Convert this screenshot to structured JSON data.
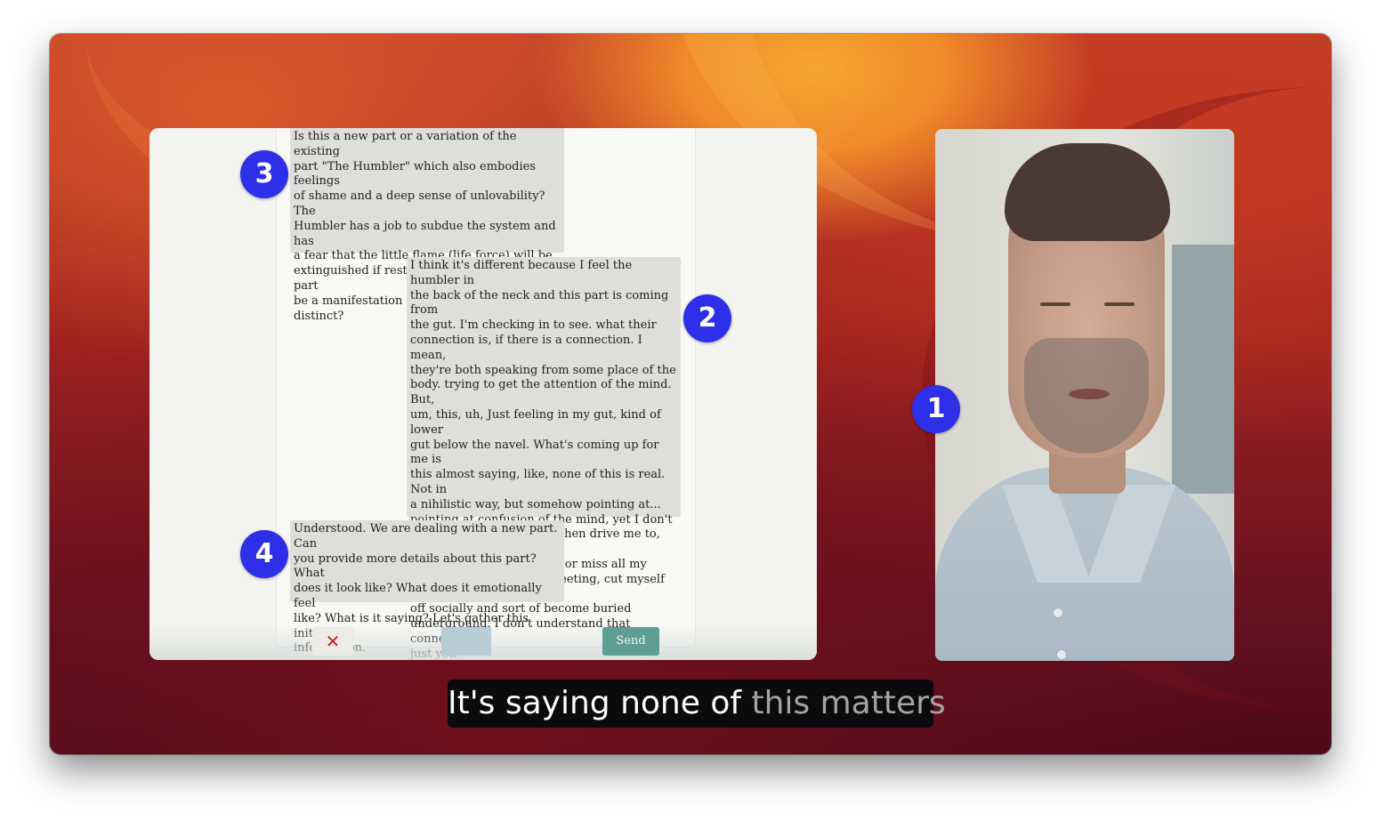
{
  "chat": {
    "messages": [
      {
        "role": "assistant",
        "text": "Is this a new part or a variation of the existing\npart \"The Humbler\" which also embodies feelings\nof shame and a deep sense of unlovability? The\nHumbler has a job to subdue the system and has\na fear that the little flame (life force) will be\nextinguished if rest isn't achieved. Could this part\nbe a manifestation of The Humbler or is it\ndistinct?"
      },
      {
        "role": "user",
        "text": "I think it's different because I feel the humbler in\nthe back of the neck and this part is coming from\nthe gut. I'm checking in to see. what their\nconnection is, if there is a connection. I mean,\nthey're both speaking from some place of the\nbody. trying to get the attention of the mind. But,\num, this, uh, Just feeling in my gut, kind of lower\ngut below the navel. What's coming up for me is\nthis almost saying, like, none of this is real. Not in\na nihilistic way, but somehow pointing at...\npointing at confusion of the mind, yet I don't\nunderstand why it would then drive me to, let's\nsay, eat a hundred M&Ms or miss all my\nmeetings, cancel every meeting, cut myself off.\noff socially and sort of become buried\nunderground. I don't understand that connection\njust yet."
      },
      {
        "role": "assistant",
        "text": "Understood. We are dealing with a new part. Can\nyou provide more details about this part? What\ndoes it look like? What does it emotionally feel\nlike? What is it saying? Let's gather this initial\ninformation."
      }
    ],
    "cancel_label": "✕",
    "send_label": "Send"
  },
  "badges": {
    "one": "1",
    "two": "2",
    "three": "3",
    "four": "4"
  },
  "caption": {
    "spoken": "It's saying none of ",
    "pending": "this matters"
  },
  "colors": {
    "badge": "#2d30e8",
    "send_button": "#5f9e95",
    "cancel_icon": "#d0281f",
    "bubble": "#dededb"
  }
}
